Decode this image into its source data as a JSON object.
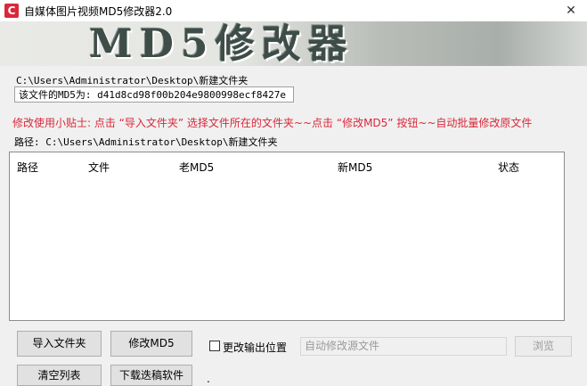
{
  "window": {
    "title": "自媒体图片视频MD5修改器2.0",
    "icon_letter": "C",
    "close_glyph": "✕"
  },
  "banner": {
    "text": "MD5修改器"
  },
  "main": {
    "selected_path": "C:\\Users\\Administrator\\Desktop\\新建文件夹",
    "md5_value": "该文件的MD5为: d41d8cd98f00b204e9800998ecf8427e",
    "tip": "修改使用小贴士: 点击 “导入文件夹” 选择文件所在的文件夹~~点击 “修改MD5” 按钮~~自动批量修改原文件",
    "path_label": "路径: C:\\Users\\Administrator\\Desktop\\新建文件夹"
  },
  "table": {
    "columns": [
      "路径",
      "文件",
      "老MD5",
      "新MD5",
      "状态"
    ],
    "rows": []
  },
  "controls": {
    "import_folder_label": "导入文件夹",
    "modify_md5_label": "修改MD5",
    "change_output_label": "更改输出位置",
    "change_output_checked": false,
    "output_placeholder": "自动修改源文件",
    "browse_label": "浏览",
    "clear_list_label": "清空列表",
    "download_label": "下载迭稿软件",
    "trailing_text": "."
  },
  "colors": {
    "accent": "#d9283a",
    "banner_text": "#3f4d49"
  }
}
